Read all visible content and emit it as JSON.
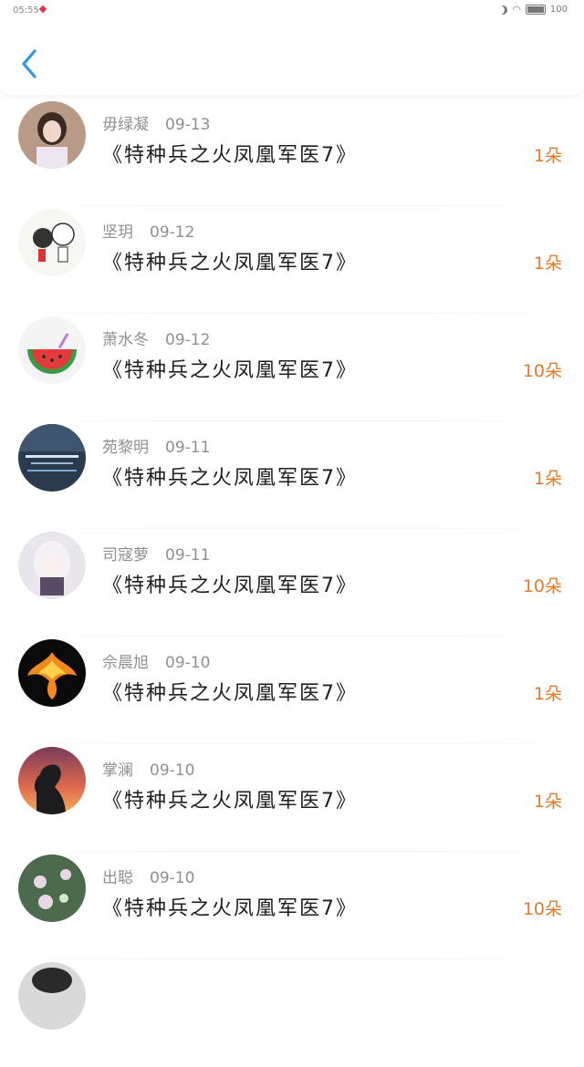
{
  "status_bar": {
    "time": "05:55",
    "battery": "100"
  },
  "header": {
    "back_icon": "chevron-left-icon",
    "accent_color": "#2d9ae0"
  },
  "items": [
    {
      "name": "毋绿凝",
      "date": "09-13",
      "title": "《特种兵之火凤凰军医7》",
      "count": "1朵",
      "avatar": {
        "bg": "#b89a86",
        "fg": "#3b2a24"
      }
    },
    {
      "name": "坚玥",
      "date": "09-12",
      "title": "《特种兵之火凤凰军医7》",
      "count": "1朵",
      "avatar": {
        "bg": "#f6f6f2",
        "fg": "#333333"
      }
    },
    {
      "name": "萧水冬",
      "date": "09-12",
      "title": "《特种兵之火凤凰军医7》",
      "count": "10朵",
      "avatar": {
        "bg": "#f4f4f4",
        "fg": "#3a9a46"
      }
    },
    {
      "name": "苑黎明",
      "date": "09-11",
      "title": "《特种兵之火凤凰军医7》",
      "count": "1朵",
      "avatar": {
        "bg": "#2a3b4e",
        "fg": "#7fa9d0"
      }
    },
    {
      "name": "司寇萝",
      "date": "09-11",
      "title": "《特种兵之火凤凰军医7》",
      "count": "10朵",
      "avatar": {
        "bg": "#e8e6ea",
        "fg": "#5a4a6a"
      }
    },
    {
      "name": "佘晨旭",
      "date": "09-10",
      "title": "《特种兵之火凤凰军医7》",
      "count": "1朵",
      "avatar": {
        "bg": "#0a0a0a",
        "fg": "#f08a1c"
      }
    },
    {
      "name": "掌澜",
      "date": "09-10",
      "title": "《特种兵之火凤凰军医7》",
      "count": "1朵",
      "avatar": {
        "bg": "#d9775e",
        "fg": "#1c1c1c"
      }
    },
    {
      "name": "出聪",
      "date": "09-10",
      "title": "《特种兵之火凤凰军医7》",
      "count": "10朵",
      "avatar": {
        "bg": "#4c6b4d",
        "fg": "#e8d8e6"
      }
    }
  ],
  "colors": {
    "count": "#e07a2f",
    "name": "#8f8f8f",
    "title": "#1e1e1e"
  }
}
